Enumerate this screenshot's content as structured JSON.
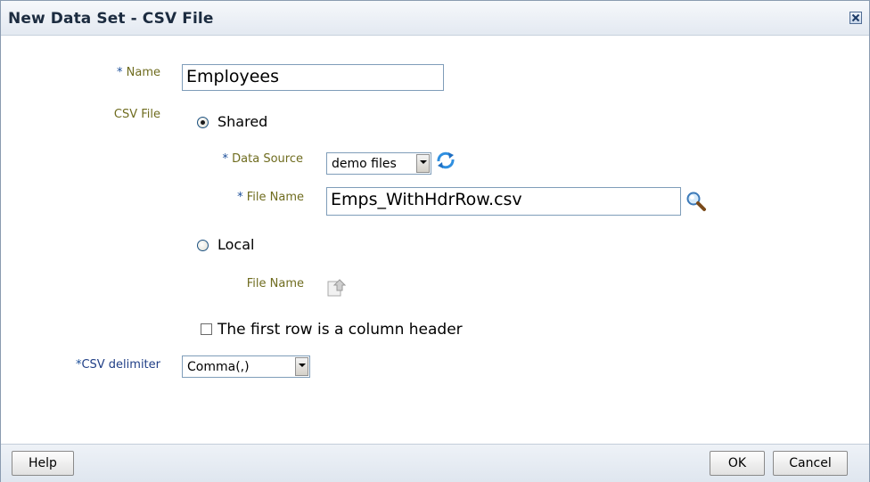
{
  "dialog": {
    "title": "New Data Set - CSV File",
    "close_icon": "close-x-icon"
  },
  "form": {
    "name": {
      "required_mark": "*",
      "label": " Name",
      "value": "Employees"
    },
    "csv_file": {
      "label": "CSV File",
      "shared": {
        "label": "Shared",
        "selected": true,
        "data_source": {
          "required_mark": "*",
          "label": " Data Source",
          "value": "demo files",
          "refresh_icon": "refresh-icon"
        },
        "file_name": {
          "required_mark": "*",
          "label": " File Name",
          "value": "Emps_WithHdrRow.csv",
          "browse_icon": "magnifier-search-icon"
        }
      },
      "local": {
        "label": "Local",
        "selected": false,
        "file_name": {
          "label": "File Name",
          "upload_icon": "upload-file-icon"
        }
      }
    },
    "header_row": {
      "label": "The first row is a column header",
      "checked": false
    },
    "csv_delimiter": {
      "required_mark": "*",
      "label": "CSV delimiter",
      "value": "Comma(,)"
    }
  },
  "footer": {
    "help_label": "Help",
    "ok_label": "OK",
    "cancel_label": "Cancel"
  },
  "colors": {
    "label_olive": "#6f6c1f",
    "required_blue": "#1a4d99",
    "border": "#7f9db9"
  }
}
